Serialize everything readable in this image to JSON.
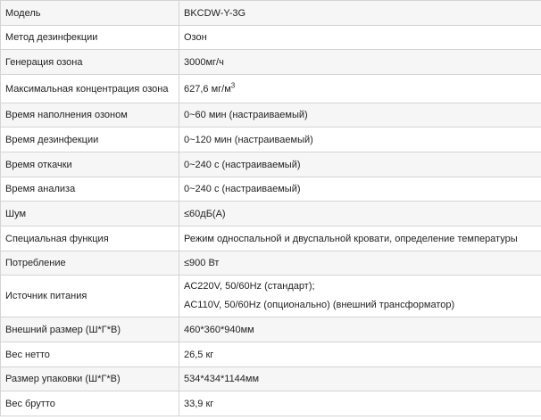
{
  "rows": [
    {
      "label": "Модель",
      "value": "BKCDW-Y-3G"
    },
    {
      "label": "Метод дезинфекции",
      "value": "Озон"
    },
    {
      "label": "Генерация озона",
      "value": "3000мг/ч"
    },
    {
      "label": "Максимальная концентрация озона",
      "value": "627,6 мг/м",
      "value_sup": "3"
    },
    {
      "label": "Время наполнения озоном",
      "value": "0~60 мин (настраиваемый)"
    },
    {
      "label": "Время дезинфекции",
      "value": "0~120 мин (настраиваемый)"
    },
    {
      "label": "Время откачки",
      "value": "0~240 с (настраиваемый)"
    },
    {
      "label": "Время анализа",
      "value": "0~240 с (настраиваемый)"
    },
    {
      "label": "Шум",
      "value": "≤60дБ(A)"
    },
    {
      "label": "Специальная функция",
      "value": "Режим односпальной и двуспальной кровати, определение температуры"
    },
    {
      "label": "Потребление",
      "value": "≤900 Вт"
    },
    {
      "label": "Источник питания",
      "value": "AC220V, 50/60Hz (стандарт);",
      "value2": "AC110V, 50/60Hz (опционально) (внешний трансформатор)"
    },
    {
      "label": "Внешний размер (Ш*Г*В)",
      "value": "460*360*940мм"
    },
    {
      "label": "Вес нетто",
      "value": "26,5 кг"
    },
    {
      "label": "Размер упаковки (Ш*Г*В)",
      "value": "534*434*1144мм"
    },
    {
      "label": "Вес брутто",
      "value": "33,9 кг"
    }
  ]
}
